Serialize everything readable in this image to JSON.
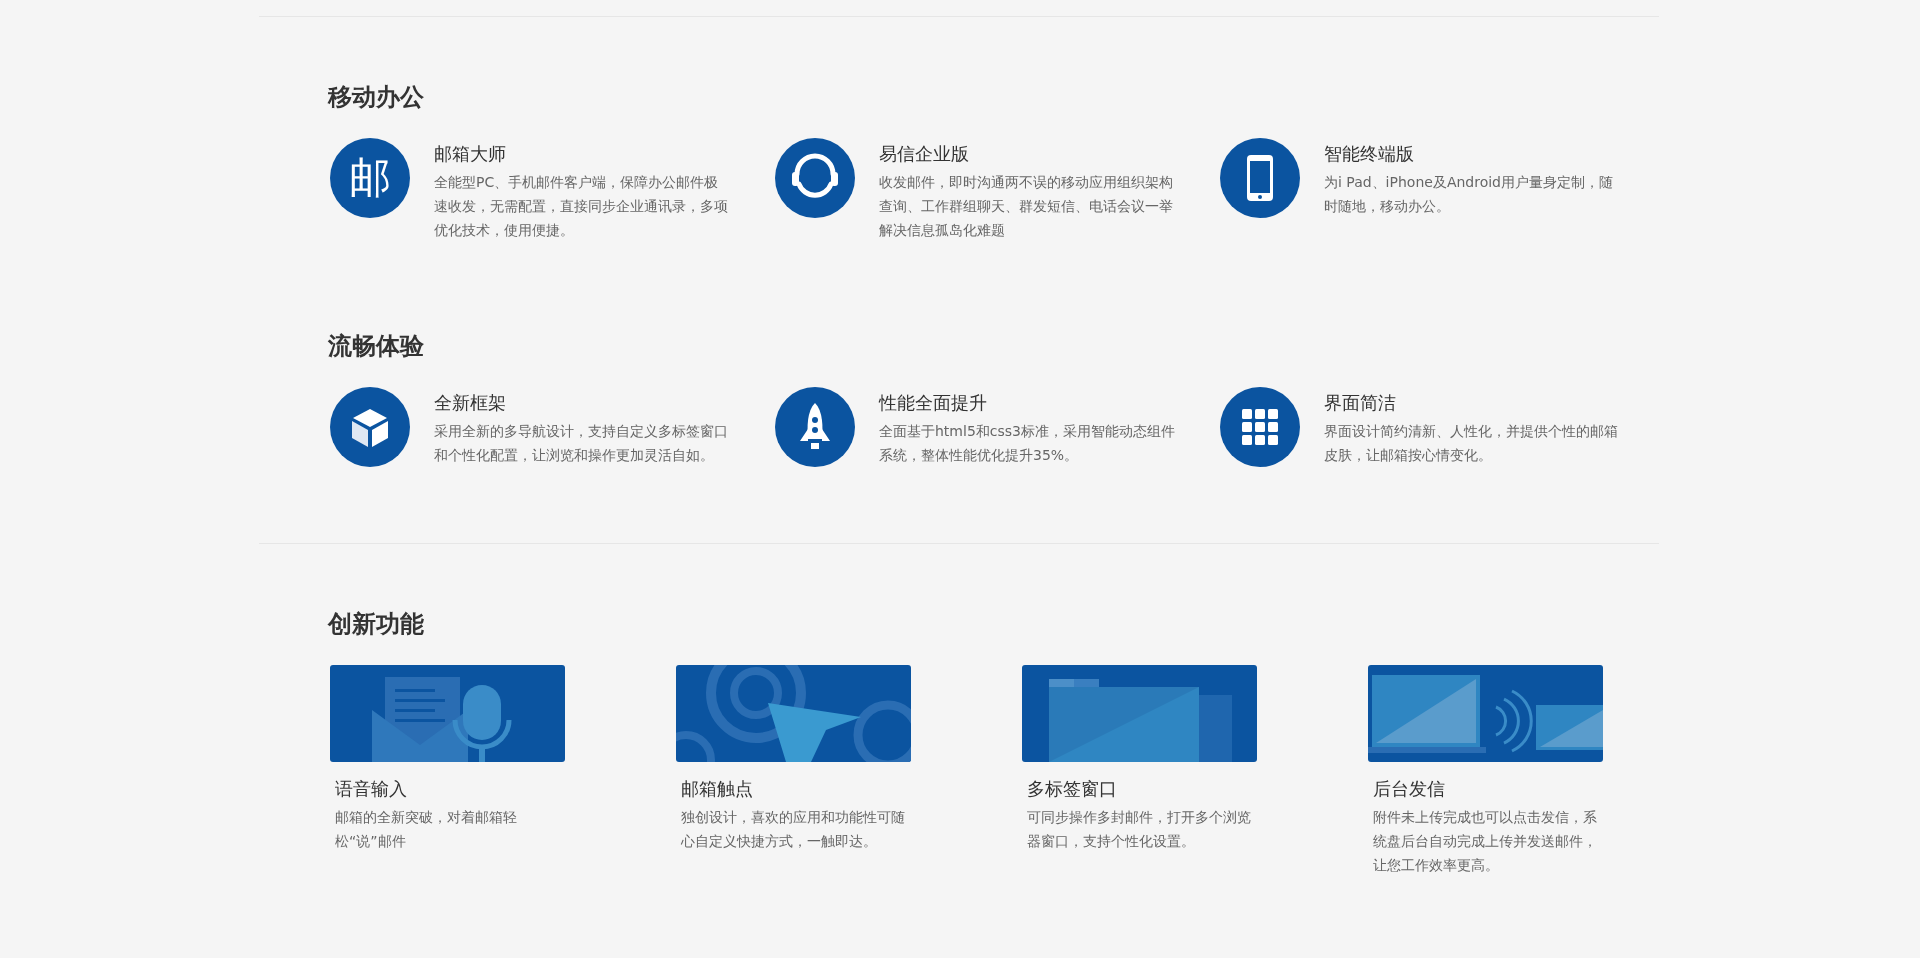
{
  "sections": [
    {
      "title": "移动办公",
      "kind": "icons",
      "items": [
        {
          "kind": "glyph",
          "glyph": "邮",
          "title": "邮箱大师",
          "description": "全能型PC、手机邮件客户端，保障办公邮件极速收发，无需配置，直接同步企业通讯录，多项优化技术，使用便捷。"
        },
        {
          "kind": "headset",
          "title": "易信企业版",
          "description": "收发邮件，即时沟通两不误的移动应用组织架构查询、工作群组聊天、群发短信、电话会议一举解决信息孤岛化难题"
        },
        {
          "kind": "phone",
          "title": "智能终端版",
          "description": "为i Pad、iPhone及Android用户量身定制，随时随地，移动办公。"
        }
      ]
    },
    {
      "title": "流畅体验",
      "kind": "icons",
      "items": [
        {
          "kind": "cube",
          "title": "全新框架",
          "description": "采用全新的多导航设计，支持自定义多标签窗口和个性化配置，让浏览和操作更加灵活自如。"
        },
        {
          "kind": "rocket",
          "title": "性能全面提升",
          "description": "全面基于html5和css3标准，采用智能动态组件系统，整体性能优化提升35%。"
        },
        {
          "kind": "grid",
          "title": "界面简洁",
          "description": "界面设计简约清新、人性化，并提供个性的邮箱皮肤，让邮箱按心情变化。"
        }
      ]
    },
    {
      "title": "创新功能",
      "kind": "cards",
      "items": [
        {
          "kind": "voice",
          "title": "语音输入",
          "description": "邮箱的全新突破，对着邮箱轻松“说”邮件"
        },
        {
          "kind": "touch",
          "title": "邮箱触点",
          "description": "独创设计，喜欢的应用和功能性可随心自定义快捷方式，一触即达。"
        },
        {
          "kind": "tabs",
          "title": "多标签窗口",
          "description": "可同步操作多封邮件，打开多个浏览器窗口，支持个性化设置。"
        },
        {
          "kind": "background",
          "title": "后台发信",
          "description": "附件未上传完成也可以点击发信，系统盘后台自动完成上传并发送邮件，让您工作效率更高。"
        }
      ]
    }
  ]
}
